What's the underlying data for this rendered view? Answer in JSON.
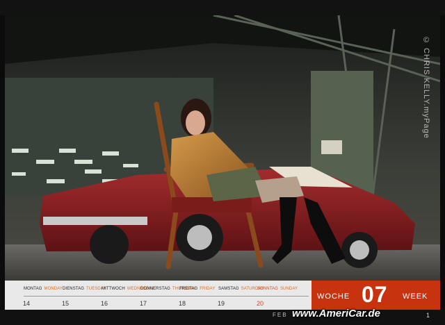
{
  "photo": {
    "credit": "© CHRIS KELLY.myPage"
  },
  "calendar": {
    "days": [
      {
        "de": "MONTAG",
        "en": "MONDAY",
        "date": "14"
      },
      {
        "de": "DIENSTAG",
        "en": "TUESDAY",
        "date": "15"
      },
      {
        "de": "MITTWOCH",
        "en": "WEDNESDAY",
        "date": "16"
      },
      {
        "de": "DONNERSTAG",
        "en": "THURSDAY",
        "date": "17"
      },
      {
        "de": "FREITAG",
        "en": "FRIDAY",
        "date": "18"
      },
      {
        "de": "SAMSTAG",
        "en": "SATURDAY",
        "date": "19"
      },
      {
        "de": "SONNTAG",
        "en": "SUNDAY",
        "date": "20"
      }
    ],
    "week": {
      "label_de": "WOCHE",
      "number": "07",
      "label_en": "WEEK"
    },
    "month": "FEB",
    "page_number": "1"
  },
  "watermark": "www.AmeriCar.de",
  "colors": {
    "accent": "#c8330f",
    "sunday": "#d0461a",
    "strip": "#e9e9e9"
  }
}
